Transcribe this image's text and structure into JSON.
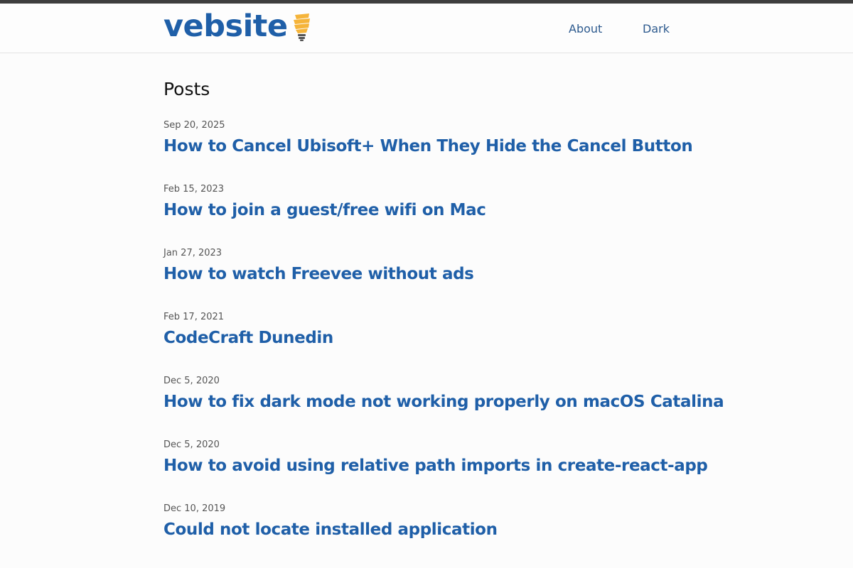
{
  "header": {
    "logo_text": "vebsite",
    "nav": [
      {
        "label": "About"
      },
      {
        "label": "Dark"
      }
    ]
  },
  "main": {
    "title": "Posts",
    "posts": [
      {
        "date": "Sep 20, 2025",
        "title": "How to Cancel Ubisoft+ When They Hide the Cancel Button"
      },
      {
        "date": "Feb 15, 2023",
        "title": "How to join a guest/free wifi on Mac"
      },
      {
        "date": "Jan 27, 2023",
        "title": "How to watch Freevee without ads"
      },
      {
        "date": "Feb 17, 2021",
        "title": "CodeCraft Dunedin"
      },
      {
        "date": "Dec 5, 2020",
        "title": "How to fix dark mode not working properly on macOS Catalina"
      },
      {
        "date": "Dec 5, 2020",
        "title": "How to avoid using relative path imports in create-react-app"
      },
      {
        "date": "Dec 10, 2019",
        "title": "Could not locate installed application"
      }
    ]
  },
  "colors": {
    "accent": "#1f5fa8",
    "nav_link": "#2d5a8e",
    "bulb": "#f5b43a",
    "top_bar": "#3e3e3e"
  },
  "icons": {
    "logo": "lightbulb-icon"
  }
}
